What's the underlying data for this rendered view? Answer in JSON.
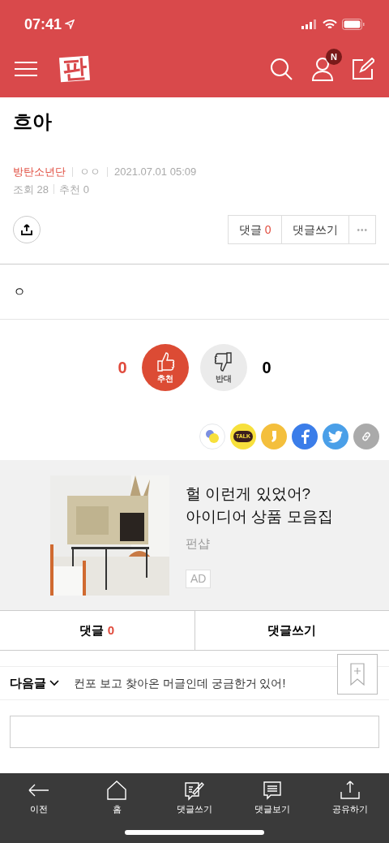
{
  "status_bar": {
    "time": "07:41"
  },
  "header": {
    "logo": "판",
    "notification_badge": "N"
  },
  "post": {
    "title": "흐아",
    "board": "방탄소년단",
    "author": "ㅇㅇ",
    "date": "2021.07.01 05:09",
    "views": "조회 28",
    "recommends": "추천 0",
    "body": "ㅇ"
  },
  "actions": {
    "comments_label": "댓글",
    "comments_count": "0",
    "write_comment": "댓글쓰기",
    "more": "•••"
  },
  "votes": {
    "up_count": "0",
    "up_label": "추천",
    "down_label": "반대",
    "down_count": "0"
  },
  "share": [
    {
      "kind": "band"
    },
    {
      "kind": "talk",
      "label": "TALK"
    },
    {
      "kind": "story"
    },
    {
      "kind": "facebook"
    },
    {
      "kind": "twitter"
    },
    {
      "kind": "link"
    }
  ],
  "ad": {
    "title": "헐 이런게 있었어?\n아이디어 상품 모음집",
    "brand": "펀샵",
    "tag": "AD"
  },
  "comment_bar": {
    "comments_label": "댓글",
    "comments_count": "0",
    "write_comment": "댓글쓰기"
  },
  "next_post": {
    "label": "다음글",
    "title": "컨포 보고 찾아온 머글인데 궁금한거 있어!"
  },
  "bottom_nav": [
    {
      "kind": "back",
      "label": "이전"
    },
    {
      "kind": "home",
      "label": "홈"
    },
    {
      "kind": "write",
      "label": "댓글쓰기"
    },
    {
      "kind": "comments",
      "label": "댓글보기"
    },
    {
      "kind": "share",
      "label": "공유하기"
    }
  ]
}
